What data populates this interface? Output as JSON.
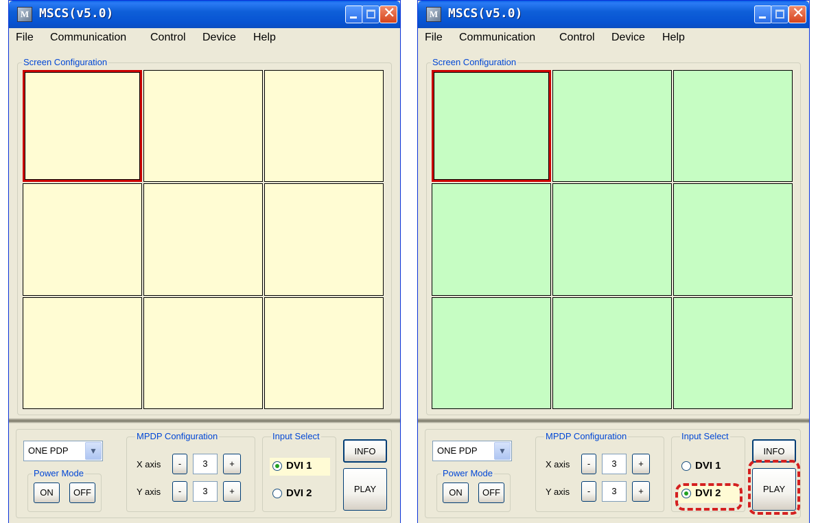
{
  "windows": [
    {
      "title": "MSCS(v5.0)",
      "menu": [
        "File",
        "Communication",
        "Control",
        "Device",
        "Help"
      ],
      "screen_config_label": "Screen Configuration",
      "cell_color": "#fffcd3",
      "grid_columns": 3,
      "grid_rows": 3,
      "selected_cell": 0,
      "panel_select": "ONE PDP",
      "power_mode_label": "Power Mode",
      "on_label": "ON",
      "off_label": "OFF",
      "mpdp_label": "MPDP Configuration",
      "x_axis_label": "X axis",
      "y_axis_label": "Y axis",
      "x_value": "3",
      "y_value": "3",
      "minus_label": "-",
      "plus_label": "+",
      "input_select_label": "Input Select",
      "dvi1_label": "DVI 1",
      "dvi2_label": "DVI 2",
      "selected_input": "DVI 1",
      "info_label": "INFO",
      "play_label": "PLAY",
      "highlight_annotations": false
    },
    {
      "title": "MSCS(v5.0)",
      "menu": [
        "File",
        "Communication",
        "Control",
        "Device",
        "Help"
      ],
      "screen_config_label": "Screen Configuration",
      "cell_color": "#c6fdc3",
      "grid_columns": 3,
      "grid_rows": 3,
      "selected_cell": 0,
      "panel_select": "ONE PDP",
      "power_mode_label": "Power Mode",
      "on_label": "ON",
      "off_label": "OFF",
      "mpdp_label": "MPDP Configuration",
      "x_axis_label": "X axis",
      "y_axis_label": "Y axis",
      "x_value": "3",
      "y_value": "3",
      "minus_label": "-",
      "plus_label": "+",
      "input_select_label": "Input Select",
      "dvi1_label": "DVI 1",
      "dvi2_label": "DVI 2",
      "selected_input": "DVI 2",
      "info_label": "INFO",
      "play_label": "PLAY",
      "highlight_annotations": true
    }
  ],
  "app_icon_glyph": "M",
  "colors": {
    "selection_border": "#cc0000",
    "annotation_dash": "#d42020"
  }
}
